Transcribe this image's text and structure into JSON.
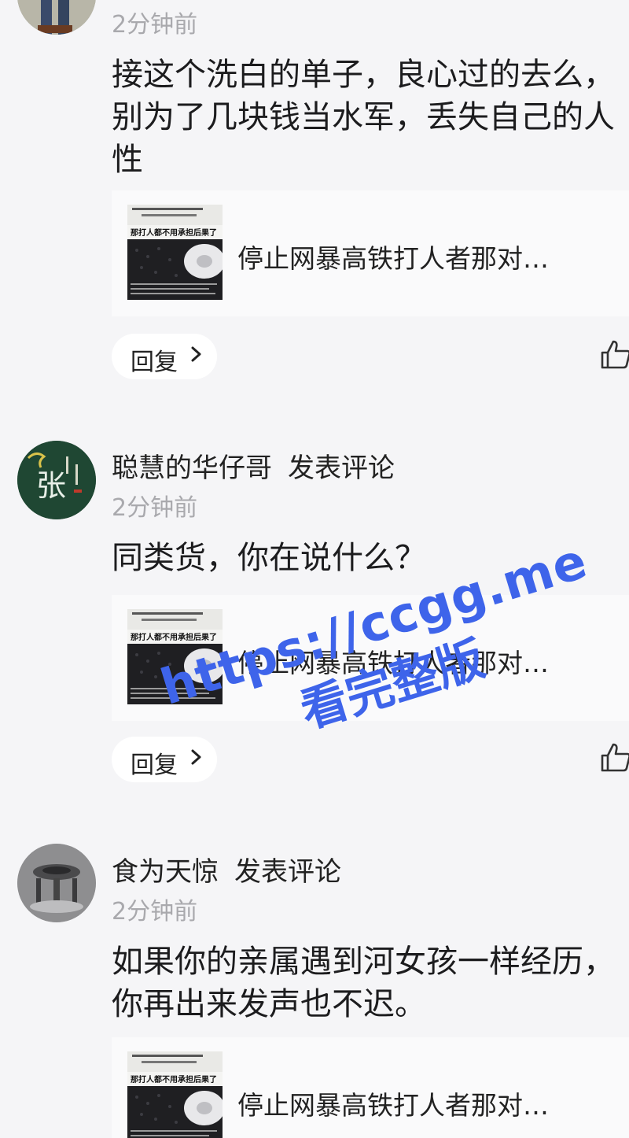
{
  "comments": [
    {
      "author": "",
      "action": "",
      "time": "2分钟前",
      "text": "接这个洗白的单子，良心过的去么，别为了几块钱当水军，丢失自己的人性",
      "card": {
        "title": "停止网暴高铁打人者那对…",
        "thumb_lines": [
          "那打人都不用承担后果了"
        ]
      },
      "reply_label": "回复"
    },
    {
      "author": "聪慧的华仔哥",
      "action": "发表评论",
      "time": "2分钟前",
      "text": "同类货，你在说什么？",
      "card": {
        "title": "停止网暴高铁打人者那对…",
        "thumb_lines": [
          "那打人都不用承担后果了"
        ]
      },
      "reply_label": "回复"
    },
    {
      "author": "食为天惊",
      "action": "发表评论",
      "time": "2分钟前",
      "text": "如果你的亲属遇到河女孩一样经历，你再出来发声也不迟。",
      "card": {
        "title": "停止网暴高铁打人者那对…",
        "thumb_lines": [
          "那打人都不用承担后果了"
        ]
      },
      "reply_label": ""
    }
  ],
  "avatar2_glyph": "张",
  "watermark": {
    "url": "https://ccgg.me",
    "text": "看完整版"
  },
  "colors": {
    "background": "#f5f5f7",
    "card": "#fafafb",
    "time": "#a9a9ad",
    "watermark": "#3e64ea"
  },
  "icons": [
    "chevron-right-icon",
    "thumbs-up-icon"
  ]
}
